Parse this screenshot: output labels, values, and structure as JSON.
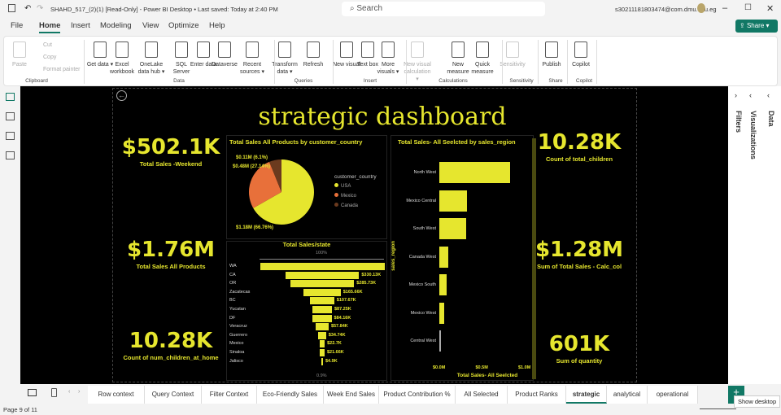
{
  "titlebar": {
    "title": "SHAHD_517_(2)(1) [Read-Only] - Power BI Desktop • Last saved: Today at 2:40 PM",
    "search": "Search",
    "user": "s30211181803474@com.dmu.edu.eg"
  },
  "menu": [
    "File",
    "Home",
    "Insert",
    "Modeling",
    "View",
    "Optimize",
    "Help"
  ],
  "share": "Share",
  "ribbon": {
    "buttons": [
      {
        "label": "Paste",
        "x": 14,
        "dis": true
      },
      {
        "label": "Get data ▾",
        "x": 113
      },
      {
        "label": "Excel workbook",
        "x": 140
      },
      {
        "label": "OneLake data hub ▾",
        "x": 176
      },
      {
        "label": "SQL Server",
        "x": 213
      },
      {
        "label": "Enter data",
        "x": 240
      },
      {
        "label": "Dataverse",
        "x": 266
      },
      {
        "label": "Recent sources ▾",
        "x": 300
      },
      {
        "label": "Transform data ▾",
        "x": 340
      },
      {
        "label": "Refresh",
        "x": 375
      },
      {
        "label": "New visual",
        "x": 416
      },
      {
        "label": "Text box",
        "x": 442
      },
      {
        "label": "More visuals ▾",
        "x": 467
      },
      {
        "label": "New visual calculation ▾",
        "x": 503,
        "dis": true
      },
      {
        "label": "New measure",
        "x": 553
      },
      {
        "label": "Quick measure",
        "x": 583
      },
      {
        "label": "Sensitivity",
        "x": 620,
        "dis": true
      },
      {
        "label": "Publish",
        "x": 668
      },
      {
        "label": "Copilot",
        "x": 704
      }
    ],
    "small": [
      "Cut",
      "Copy",
      "Format painter"
    ],
    "groups": [
      {
        "label": "Clipboard",
        "x": 40
      },
      {
        "label": "Data",
        "x": 215
      },
      {
        "label": "Queries",
        "x": 368
      },
      {
        "label": "Insert",
        "x": 450
      },
      {
        "label": "Calculations",
        "x": 552
      },
      {
        "label": "Sensitivity",
        "x": 636
      },
      {
        "label": "Share",
        "x": 678
      },
      {
        "label": "Copilot",
        "x": 713
      }
    ]
  },
  "panels": {
    "filters": "Filters",
    "visualizations": "Visualizations",
    "data": "Data"
  },
  "dashboard": {
    "title": "strategic dashboard",
    "kpis": [
      {
        "value": "$502.1K",
        "label": "Total Sales -Weekend"
      },
      {
        "value": "$1.76M",
        "label": "Total Sales All Products"
      },
      {
        "value": "10.28K",
        "label": "Count of num_children_at_home"
      },
      {
        "value": "10.28K",
        "label": "Count of total_children"
      },
      {
        "value": "$1.28M",
        "label": "Sum of Total Sales - Calc_col"
      },
      {
        "value": "601K",
        "label": "Sum of quantity"
      }
    ]
  },
  "chart_data": [
    {
      "type": "pie",
      "title": "Total Sales All Products by customer_country",
      "legend_title": "customer_country",
      "slices": [
        {
          "name": "USA",
          "value": 1.18,
          "pct": 66.76,
          "label": "$1.18M (66.76%)",
          "color": "#e6e62e"
        },
        {
          "name": "Mexico",
          "value": 0.48,
          "pct": 27.14,
          "label": "$0.48M (27.14%)",
          "color": "#e8703a"
        },
        {
          "name": "Canada",
          "value": 0.11,
          "pct": 6.1,
          "label": "$0.11M (6.1%)",
          "color": "#6b3a1e"
        }
      ]
    },
    {
      "type": "bar",
      "subtype": "funnel",
      "title": "Total Sales/state",
      "top_label": "100%",
      "bottom_label": "0.9%",
      "categories": [
        "WA",
        "CA",
        "OR",
        "Zacatecas",
        "BC",
        "Yucatan",
        "DF",
        "Veracruz",
        "Guerrero",
        "Mexico",
        "Sinaloa",
        "Jalisco"
      ],
      "values": [
        557000,
        330130,
        285730,
        165660,
        107670,
        87250,
        84160,
        57840,
        34740,
        22700,
        21660,
        4900
      ],
      "labels": [
        "",
        "$330.13K",
        "$285.73K",
        "$165.66K",
        "$107.67K",
        "$87.25K",
        "$84.16K",
        "$57.84K",
        "$34.74K",
        "$22.7K",
        "$21.66K",
        "$4.9K"
      ]
    },
    {
      "type": "bar",
      "orientation": "horizontal",
      "title": "Total Sales- All Seelcted by sales_region",
      "xlabel": "Total Sales- All Seelcted",
      "ylabel": "sales_region",
      "categories": [
        "North West",
        "Mexico Central",
        "South West",
        "Canada West",
        "Mexico South",
        "Mexico West",
        "Central West"
      ],
      "values": [
        0.83,
        0.32,
        0.31,
        0.1,
        0.09,
        0.06,
        0.005
      ],
      "xlim": [
        0,
        1.0
      ],
      "xticks": [
        "$0.0M",
        "$0.5M",
        "$1.0M"
      ]
    }
  ],
  "tabs": [
    "Row context",
    "Query Context",
    "Filter Context",
    "Eco-Friendly Sales",
    "Week End Sales",
    "Product Contribution %",
    "All Selected",
    "Product Ranks",
    "strategic",
    "analytical",
    "operational"
  ],
  "active_tab": "strategic",
  "status": {
    "page": "Page 9 of 11",
    "tooltip": "Show desktop"
  }
}
